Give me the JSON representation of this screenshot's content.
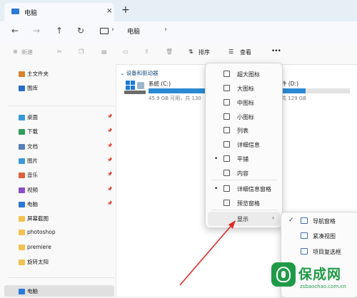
{
  "window": {
    "tab_title": "电脑",
    "tab_close": "×",
    "new_tab": "+"
  },
  "address": {
    "back": "←",
    "forward": "→",
    "up": "↑",
    "refresh": "↻",
    "sep1": "›",
    "crumb": "电脑",
    "sep2": "›"
  },
  "commands": {
    "new": "新建",
    "sort": "排序",
    "view": "查看",
    "more": "•••"
  },
  "sidebar": {
    "quick": [
      {
        "label": "主文件夹",
        "color": "#d9822b"
      },
      {
        "label": "图库",
        "color": "#2b6cc4"
      }
    ],
    "pinned": [
      {
        "label": "桌面",
        "color": "#3a9ad9"
      },
      {
        "label": "下载",
        "color": "#2f9e5b"
      },
      {
        "label": "文档",
        "color": "#5b7fb8"
      },
      {
        "label": "图片",
        "color": "#3a9ad9"
      },
      {
        "label": "音乐",
        "color": "#e0603c"
      },
      {
        "label": "视频",
        "color": "#8a4ec5"
      },
      {
        "label": "电脑",
        "color": "#2b78d6"
      }
    ],
    "folders": [
      {
        "label": "屏幕截图",
        "color": "#f2c14e"
      },
      {
        "label": "photoshop",
        "color": "#f2c14e"
      },
      {
        "label": "premiere",
        "color": "#f2c14e"
      },
      {
        "label": "旋转太阳",
        "color": "#f2c14e"
      }
    ],
    "selected": "电脑",
    "pin_glyph": "📌"
  },
  "main": {
    "group_header": "设备和驱动器",
    "drive_c": {
      "name": "系统 (C:)",
      "info": "45.9 GB 可用，共 130",
      "used_fraction": 0.65
    },
    "drive_d": {
      "name": "件 (D:)",
      "info": "共 129 GB",
      "used_fraction": 0.35
    }
  },
  "view_menu": {
    "items": [
      {
        "label": "超大图标",
        "dot": ""
      },
      {
        "label": "大图标",
        "dot": ""
      },
      {
        "label": "中图标",
        "dot": ""
      },
      {
        "label": "小图标",
        "dot": ""
      },
      {
        "label": "列表",
        "dot": ""
      },
      {
        "label": "详细信息",
        "dot": ""
      },
      {
        "label": "平铺",
        "dot": "•"
      },
      {
        "label": "内容",
        "dot": ""
      },
      {
        "label": "详细信息窗格",
        "dot": "•"
      },
      {
        "label": "预览窗格",
        "dot": ""
      },
      {
        "label": "显示",
        "dot": ""
      }
    ],
    "show_arrow": "›"
  },
  "show_submenu": {
    "items": [
      {
        "label": "导航窗格",
        "check": "✓"
      },
      {
        "label": "紧凑视图",
        "check": ""
      },
      {
        "label": "项目复选框",
        "check": ""
      }
    ]
  },
  "watermark": {
    "brand": "保成网",
    "url": "zsbaochao.com.cn"
  }
}
